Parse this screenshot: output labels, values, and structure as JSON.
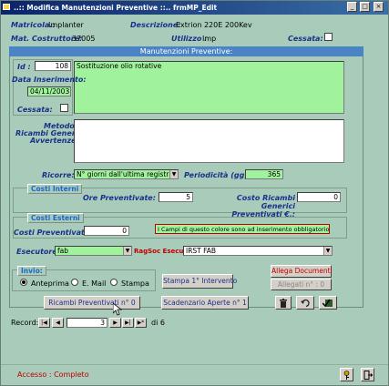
{
  "window": {
    "title": "..:: Modifica Manutenzioni Preventive ::..   frmMP_Edit"
  },
  "header": {
    "matricola_label": "Matricola.:",
    "matricola_value": "Implanter",
    "descrizione_label": "Descrizione:",
    "descrizione_value": "Extrion 220E 200Kev",
    "mat_costruttore_label": "Mat. Costruttore:",
    "mat_costruttore_value": "37005",
    "utilizzo_label": "Utilizzo :",
    "utilizzo_value": "Imp",
    "cessata_label": "Cessata:"
  },
  "panel": {
    "title": "Manutenzioni Preventive:",
    "id_label": "Id :",
    "id_value": "108",
    "description_value": "Sostituzione olio rotative",
    "data_inserimento_label": "Data Inserimento:",
    "data_inserimento_value": "04/11/2003",
    "cessata_label": "Cessata:",
    "metodo_label": "Metodo:",
    "ricambi_label": "Ricambi Generici:",
    "avvertenze_label": "Avvertenze:",
    "ricorre_label": "Ricorre:",
    "ricorre_value": "N° giorni dall'ultima registrazione",
    "periodicita_label": "Periodicità (gg):",
    "periodicita_value": "365",
    "costi_interni_label": "Costi Interni",
    "ore_preventivate_label": "Ore Preventivate:",
    "ore_preventivate_value": "5",
    "costo_ricambi_label": "Costo Ricambi Generici Preventivati €.:",
    "costo_ricambi_value": "0",
    "costi_esterni_label": "Costi Esterni",
    "costi_preventivati_label": "Costi Preventivati €.:",
    "costi_preventivati_value": "0",
    "obbligatorio_note": "I Campi di questo colore sono ad inserimento obbligatorio",
    "esecutore_label": "Esecutore:",
    "esecutore_value": "fab",
    "ragsoc_label": "RagSoc Esecutore:",
    "ragsoc_value": "IRST FAB",
    "invio_label": "Invio:",
    "radio_anteprima": "Anteprima",
    "radio_email": "E. Mail",
    "radio_stampa": "Stampa",
    "stampa_button": "Stampa 1° Intervento",
    "allega_button": "Allega Documenti",
    "allegati_button": "Allegati n° : 0",
    "ricambi_button": "Ricambi Preventivati n° 0",
    "scadenzario_button": "Scadenzario Aperte n° 1"
  },
  "record_nav": {
    "label": "Record:",
    "current": "3",
    "total_text": "di 6"
  },
  "status": {
    "access_text": "Accesso : Completo"
  },
  "colors": {
    "form_bg": "#a8ccb9",
    "required_green": "#a0f29c",
    "label_blue": "#1a2f8c",
    "header_blue": "#4a84c4",
    "alert_red": "#c00000"
  }
}
